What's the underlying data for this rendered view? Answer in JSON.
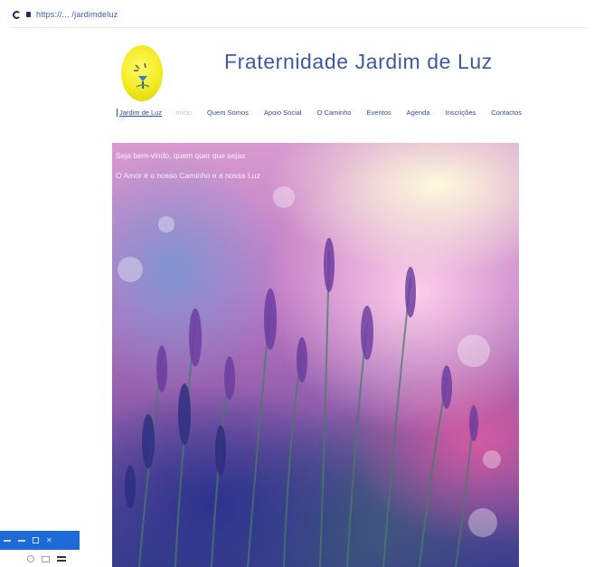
{
  "browser": {
    "url": "https://... /jardimdeluz"
  },
  "site": {
    "title": "Fraternidade Jardim de Luz",
    "logo_icon": "flower-sun-logo-icon"
  },
  "nav": {
    "items": [
      {
        "label": "Jardim de Luz"
      },
      {
        "label": "Início"
      },
      {
        "label": "Quem Somos"
      },
      {
        "label": "Apoio Social"
      },
      {
        "label": "O Caminho"
      },
      {
        "label": "Eventos"
      },
      {
        "label": "Agenda"
      },
      {
        "label": "Inscrições"
      },
      {
        "label": "Contactos"
      }
    ]
  },
  "hero": {
    "line1": "Seja bem-vindo, quem quer que sejas",
    "line2": "O Amor é o nosso Caminho e a nossa Luz"
  },
  "colors": {
    "title": "#3d5a9c",
    "nav": "#2f4f9a",
    "taskbar": "#1e6ad8"
  }
}
